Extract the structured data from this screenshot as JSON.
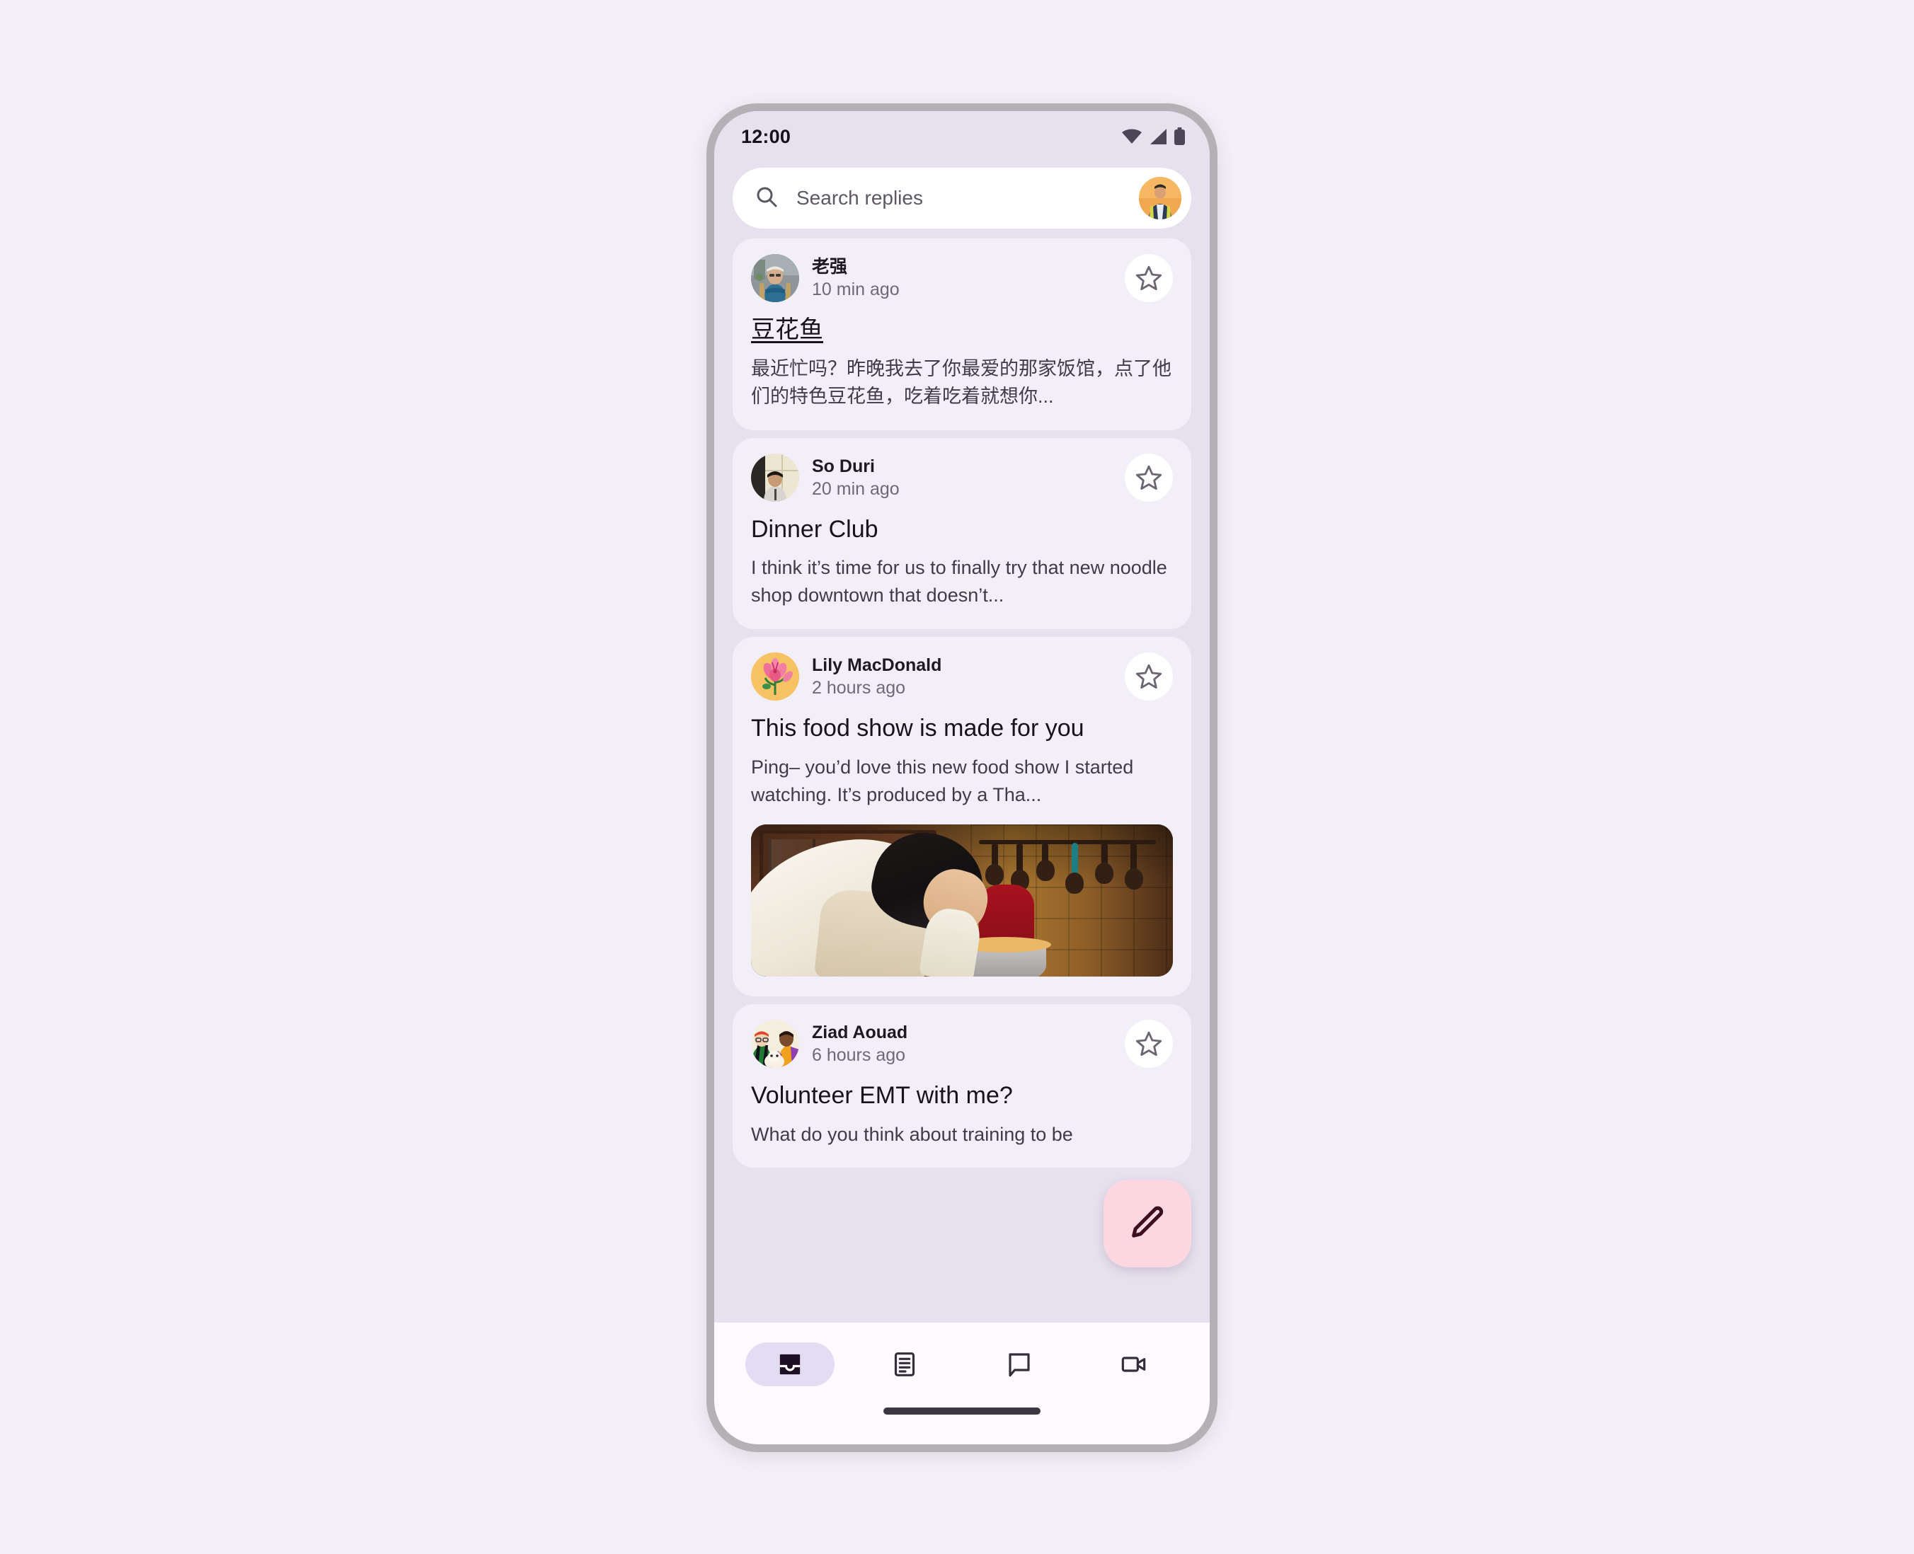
{
  "status_bar": {
    "time": "12:00",
    "icons": [
      "wifi-icon",
      "cellular-signal-icon",
      "battery-icon"
    ]
  },
  "search": {
    "placeholder": "Search replies",
    "value": "",
    "icon": "search-icon",
    "avatar": "account-avatar"
  },
  "messages": [
    {
      "sender": "老强",
      "time": "10 min ago",
      "subject": "豆花鱼",
      "subject_underlined": true,
      "preview": "最近忙吗？昨晚我去了你最爱的那家饭馆，点了他们的特色豆花鱼，吃着吃着就想你...",
      "avatar": "older-man-in-cap-photo",
      "starred": false,
      "has_image": false
    },
    {
      "sender": "So Duri",
      "time": "20 min ago",
      "subject": "Dinner Club",
      "subject_underlined": false,
      "preview": "I think it’s time for us to finally try that new noodle shop downtown that doesn’t...",
      "avatar": "person-by-window-photo",
      "starred": false,
      "has_image": false
    },
    {
      "sender": "Lily MacDonald",
      "time": "2 hours ago",
      "subject": "This food show is made for you",
      "subject_underlined": false,
      "preview": "Ping– you’d love this new food show I started watching. It’s produced by a Tha...",
      "avatar": "pink-lily-flower-illustration",
      "starred": false,
      "has_image": true,
      "image_alt": "person-baking-in-kitchen-photo"
    },
    {
      "sender": "Ziad Aouad",
      "time": "6 hours ago",
      "subject": "Volunteer EMT with me?",
      "subject_underlined": false,
      "preview": "What do you think about training to be",
      "avatar": "two-people-with-dog-illustration",
      "starred": false,
      "has_image": false
    }
  ],
  "fab": {
    "label": "Compose",
    "icon": "pencil-edit-icon",
    "color": "#FBD8E1",
    "icon_color": "#3D0D20"
  },
  "bottom_nav": {
    "items": [
      {
        "name": "inbox",
        "icon": "inbox-icon",
        "active": true
      },
      {
        "name": "articles",
        "icon": "article-icon",
        "active": false
      },
      {
        "name": "chat",
        "icon": "chat-bubble-icon",
        "active": false
      },
      {
        "name": "video",
        "icon": "video-camera-icon",
        "active": false
      }
    ]
  },
  "theme": {
    "page_background": "#F5F0F7",
    "screen_background": "#E7E1EF",
    "card_background": "#F3EFF8",
    "nav_background": "#FDFBFF",
    "active_pill": "#E4DCF3",
    "frame": "#B3B1B6"
  }
}
